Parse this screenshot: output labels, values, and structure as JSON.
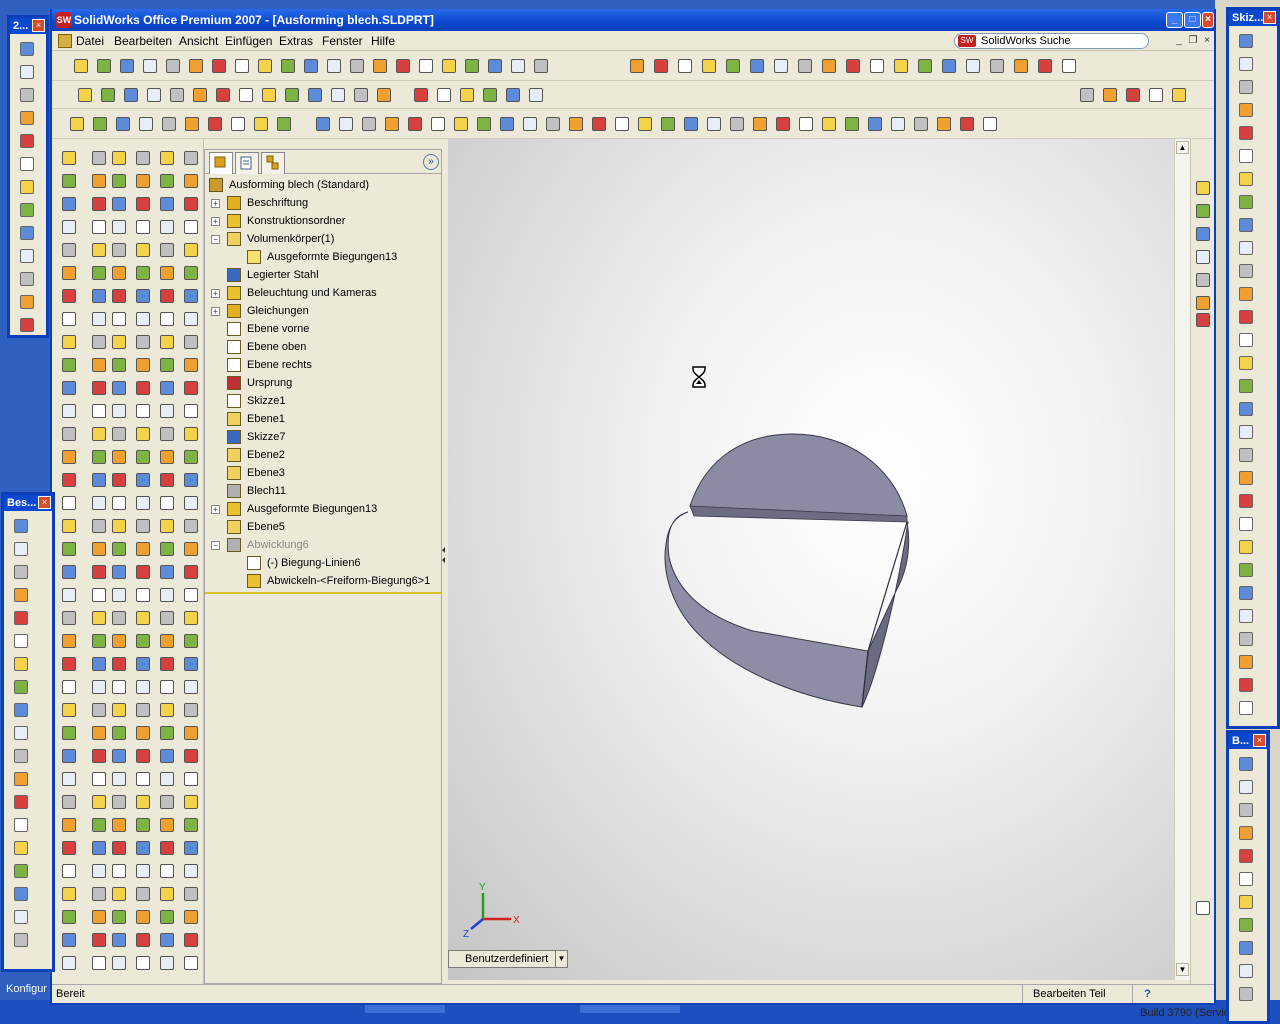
{
  "window": {
    "title": "SolidWorks Office Premium 2007 - [Ausforming blech.SLDPRT]",
    "logo_text": "SW",
    "controls": [
      "_",
      "□",
      "×"
    ]
  },
  "menu": {
    "items": [
      "Datei",
      "Bearbeiten",
      "Ansicht",
      "Einfügen",
      "Extras",
      "Fenster",
      "Hilfe"
    ],
    "search_label": "SolidWorks Suche",
    "search_logo": "SW"
  },
  "tree": {
    "rows": [
      {
        "label": "Ausforming blech  (Standard)",
        "level": 0,
        "expander": "",
        "icon": "part-icon",
        "color": "#c89b2a"
      },
      {
        "label": "Beschriftung",
        "level": 1,
        "expander": "+",
        "icon": "annotations-icon",
        "color": "#e0b020"
      },
      {
        "label": "Konstruktionsordner",
        "level": 1,
        "expander": "+",
        "icon": "design-binder-icon",
        "color": "#e8c030"
      },
      {
        "label": "Volumenkörper(1)",
        "level": 1,
        "expander": "−",
        "icon": "solid-bodies-folder-icon",
        "color": "#f0d060"
      },
      {
        "label": "Ausgeformte Biegungen13",
        "level": 2,
        "expander": "",
        "icon": "body-icon",
        "color": "#f7e070"
      },
      {
        "label": "Legierter Stahl",
        "level": 1,
        "expander": "",
        "icon": "material-icon",
        "color": "#3a6ac0"
      },
      {
        "label": "Beleuchtung und Kameras",
        "level": 1,
        "expander": "+",
        "icon": "lights-icon",
        "color": "#e8c030"
      },
      {
        "label": "Gleichungen",
        "level": 1,
        "expander": "+",
        "icon": "equations-icon",
        "color": "#e0b020"
      },
      {
        "label": "Ebene vorne",
        "level": 1,
        "expander": "",
        "icon": "plane-icon",
        "color": "#ffffff"
      },
      {
        "label": "Ebene oben",
        "level": 1,
        "expander": "",
        "icon": "plane-icon",
        "color": "#ffffff"
      },
      {
        "label": "Ebene rechts",
        "level": 1,
        "expander": "",
        "icon": "plane-icon",
        "color": "#ffffff"
      },
      {
        "label": "Ursprung",
        "level": 1,
        "expander": "",
        "icon": "origin-icon",
        "color": "#c03030"
      },
      {
        "label": "Skizze1",
        "level": 1,
        "expander": "",
        "icon": "sketch-icon",
        "color": "#ffffff"
      },
      {
        "label": "Ebene1",
        "level": 1,
        "expander": "",
        "icon": "plane-icon",
        "color": "#f0d060"
      },
      {
        "label": "Skizze7",
        "level": 1,
        "expander": "",
        "icon": "sketch-icon",
        "color": "#3a6ac0"
      },
      {
        "label": "Ebene2",
        "level": 1,
        "expander": "",
        "icon": "plane-icon",
        "color": "#f0d060"
      },
      {
        "label": "Ebene3",
        "level": 1,
        "expander": "",
        "icon": "plane-icon",
        "color": "#f0d060"
      },
      {
        "label": "Blech11",
        "level": 1,
        "expander": "",
        "icon": "sheet-metal-icon",
        "color": "#b0b0b0"
      },
      {
        "label": "Ausgeformte Biegungen13",
        "level": 1,
        "expander": "+",
        "icon": "lofted-bend-icon",
        "color": "#e8c030"
      },
      {
        "label": "Ebene5",
        "level": 1,
        "expander": "",
        "icon": "plane-icon",
        "color": "#f0d060"
      },
      {
        "label": "Abwicklung6",
        "level": 1,
        "expander": "−",
        "icon": "flatten-icon",
        "color": "#b0b0b0",
        "dim": true
      },
      {
        "label": "(-) Biegung-Linien6",
        "level": 2,
        "expander": "",
        "icon": "bend-lines-icon",
        "color": "#ffffff"
      },
      {
        "label": "Abwickeln-<Freiform-Biegung6>1",
        "level": 2,
        "expander": "",
        "icon": "flatten-bend-icon",
        "color": "#e8c030"
      }
    ]
  },
  "viewport": {
    "configuration_label": "Benutzerdefiniert",
    "axis_labels": {
      "x": "X",
      "y": "Y",
      "z": "Z"
    },
    "body_color": "#8c8ca3"
  },
  "status": {
    "left": "Bereit",
    "right": "Bearbeiten Teil",
    "help": "?"
  },
  "floats": {
    "top_left_title": "2...",
    "left_title": "Bes...",
    "right_top_title": "Skiz...",
    "right_bottom_title": "B..."
  },
  "desktop": {
    "konfig": "Konfigur",
    "build": "Build 3790 (Servic"
  }
}
